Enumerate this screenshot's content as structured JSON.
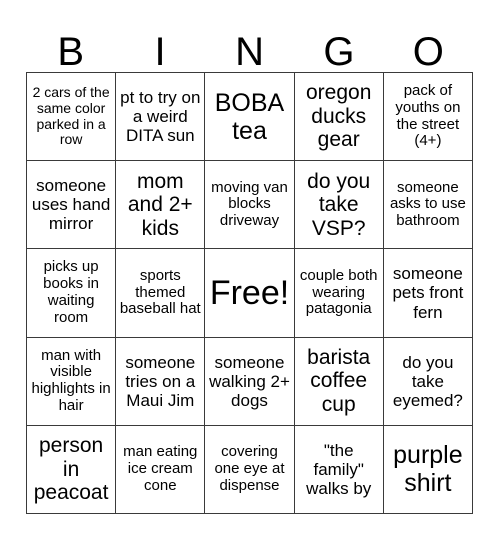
{
  "header": {
    "letters": [
      "B",
      "I",
      "N",
      "G",
      "O"
    ]
  },
  "grid": {
    "rows": 5,
    "columns": 5,
    "cells": [
      {
        "text": "2 cars of the same color parked in a row",
        "size": "xs",
        "free": false
      },
      {
        "text": "pt to try on a weird DITA sun",
        "size": "m",
        "free": false
      },
      {
        "text": "BOBA tea",
        "size": "xl",
        "free": false
      },
      {
        "text": "oregon ducks gear",
        "size": "l",
        "free": false
      },
      {
        "text": "pack of youths on the street (4+)",
        "size": "s",
        "free": false
      },
      {
        "text": "someone uses hand mirror",
        "size": "m",
        "free": false
      },
      {
        "text": "mom and 2+ kids",
        "size": "l",
        "free": false
      },
      {
        "text": "moving van blocks driveway",
        "size": "s",
        "free": false
      },
      {
        "text": "do you take VSP?",
        "size": "l",
        "free": false
      },
      {
        "text": "someone asks to use bathroom",
        "size": "s",
        "free": false
      },
      {
        "text": "picks up books in waiting room",
        "size": "s",
        "free": false
      },
      {
        "text": "sports themed baseball hat",
        "size": "s",
        "free": false
      },
      {
        "text": "Free!",
        "size": "xxl",
        "free": true
      },
      {
        "text": "couple both wearing patagonia",
        "size": "s",
        "free": false
      },
      {
        "text": "someone pets front fern",
        "size": "m",
        "free": false
      },
      {
        "text": "man with visible highlights in hair",
        "size": "s",
        "free": false
      },
      {
        "text": "someone tries on a Maui Jim",
        "size": "m",
        "free": false
      },
      {
        "text": "someone walking 2+ dogs",
        "size": "m",
        "free": false
      },
      {
        "text": "barista coffee cup",
        "size": "l",
        "free": false
      },
      {
        "text": "do you take eyemed?",
        "size": "m",
        "free": false
      },
      {
        "text": "person in peacoat",
        "size": "l",
        "free": false
      },
      {
        "text": "man eating ice cream cone",
        "size": "s",
        "free": false
      },
      {
        "text": "covering one eye at dispense",
        "size": "s",
        "free": false
      },
      {
        "text": "\"the family\" walks by",
        "size": "m",
        "free": false
      },
      {
        "text": "purple shirt",
        "size": "xl",
        "free": false
      }
    ]
  },
  "colors": {
    "background": "#ffffff",
    "text": "#000000",
    "border": "#3a3a3a"
  }
}
